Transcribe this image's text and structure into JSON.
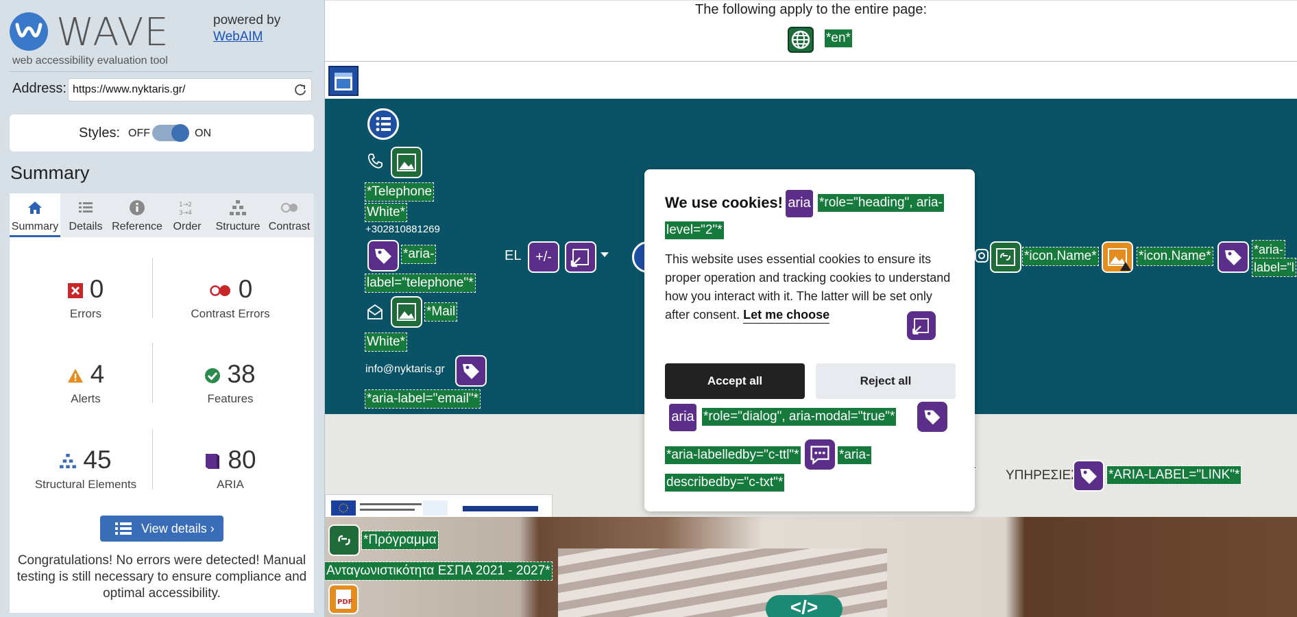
{
  "wave": {
    "logo_text": "WAVE",
    "logo_sub": "web accessibility evaluation tool",
    "powered_by": "powered by",
    "webaim": "WebAIM",
    "address_label": "Address:",
    "address_value": "https://www.nyktaris.gr/",
    "styles_label": "Styles:",
    "styles_off": "OFF",
    "styles_on": "ON",
    "summary_title": "Summary",
    "tabs": [
      {
        "label": "Summary",
        "icon": "home-icon"
      },
      {
        "label": "Details",
        "icon": "list-icon"
      },
      {
        "label": "Reference",
        "icon": "info-icon"
      },
      {
        "label": "Order",
        "icon": "order-icon"
      },
      {
        "label": "Structure",
        "icon": "structure-icon"
      },
      {
        "label": "Contrast",
        "icon": "contrast-icon"
      }
    ],
    "stats": {
      "errors": {
        "value": "0",
        "label": "Errors"
      },
      "contrast_errors": {
        "value": "0",
        "label": "Contrast Errors"
      },
      "alerts": {
        "value": "4",
        "label": "Alerts"
      },
      "features": {
        "value": "38",
        "label": "Features"
      },
      "structural": {
        "value": "45",
        "label": "Structural Elements"
      },
      "aria": {
        "value": "80",
        "label": "ARIA"
      }
    },
    "view_details": "View details ›",
    "congrats": "Congratulations! No errors were detected! Manual testing is still necessary to ensure compliance and optimal accessibility."
  },
  "page": {
    "apply_text": "The following apply to the entire page:",
    "lang_tag": "*en*",
    "tel_tag_1": "*Telephone",
    "tel_tag_2": "White*",
    "phone": "+302810881269",
    "aria_tel_1": "*aria-",
    "aria_tel_2": "label=\"telephone\"*",
    "mail_tag_1": "*Mail",
    "mail_tag_2": "White*",
    "email": "info@nyktaris.gr",
    "aria_email": "*aria-label=\"email\"*",
    "lang_el": "EL",
    "plusminus": "+/-",
    "icon_name_1": "*icon.Name*",
    "icon_name_2": "*icon.Name*",
    "aria_label_a": "*aria-",
    "aria_label_b": "label=\"l",
    "cookie_title": "We use cookies!",
    "aria_badge": "aria",
    "role_heading_1": "*role=\"heading\", aria-",
    "role_heading_2": "level=\"2\"*",
    "cookie_text": "This website uses essential cookies to ensure its proper operation and tracking cookies to understand how you interact with it. The latter will be set only after consent.",
    "let_me_choose": "Let me choose",
    "accept_all": "Accept all",
    "reject_all": "Reject all",
    "role_dialog": "*role=\"dialog\", aria-modal=\"true\"*",
    "labelledby": "*aria-labelledby=\"c-ttl\"*",
    "describedby_1": "*aria-",
    "describedby_2": "describedby=\"c-txt\"*",
    "services": "ΥΠΗΡΕΣΙΕΣ",
    "aria_link": "*ARIA-LABEL=\"LINK\"*",
    "program_1": "*Πρόγραμμα",
    "program_2": "Ανταγωνιστικότητα ΕΣΠΑ 2021 - 2027*",
    "code_symbol": "</>"
  }
}
